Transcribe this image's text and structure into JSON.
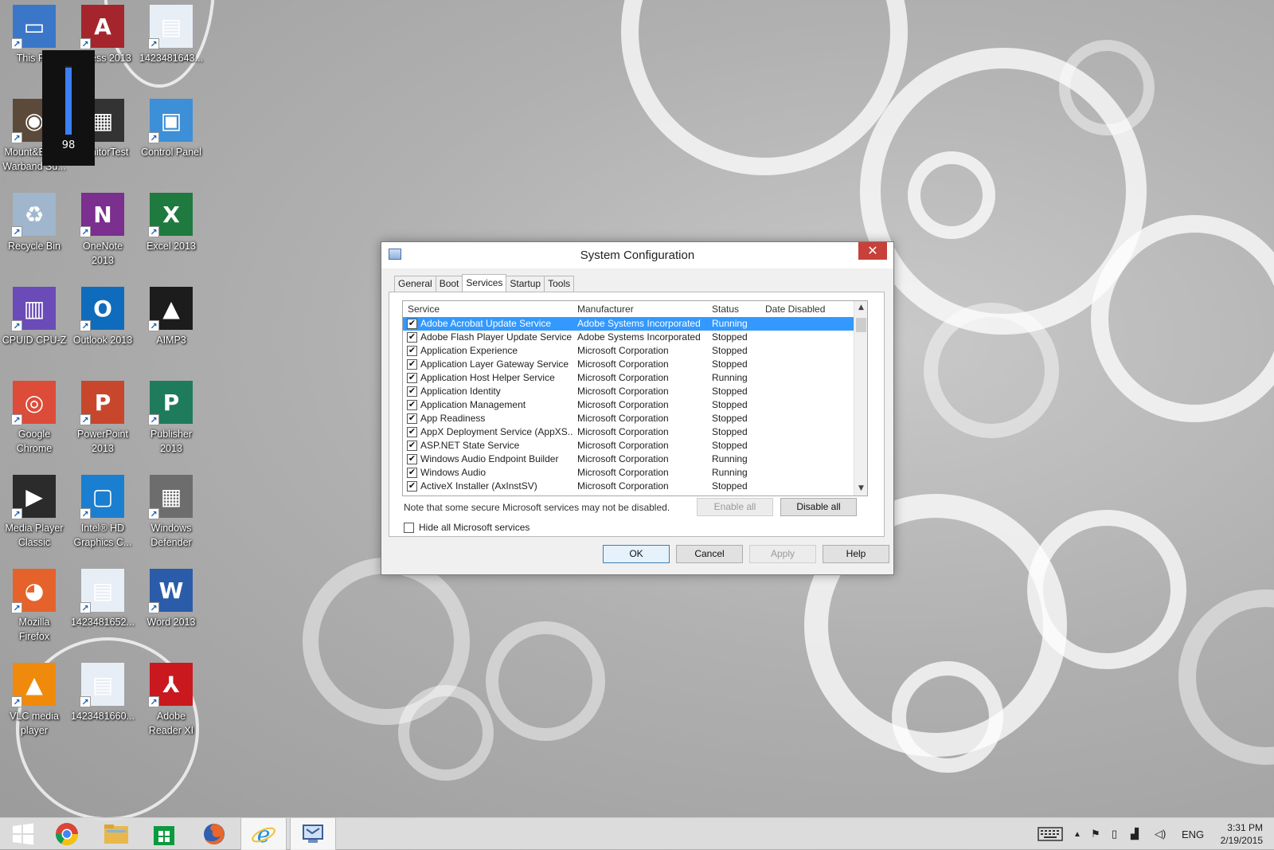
{
  "desktop": {
    "icons": [
      {
        "label": "This PC",
        "color": "#3a77c9",
        "glyph": "▭"
      },
      {
        "label": "Access 2013",
        "color": "#a4262c",
        "glyph": "A"
      },
      {
        "label": "1423481643...",
        "color": "#e8eef6",
        "glyph": "▤"
      },
      {
        "label": "Mount&Blade\nWarband Su...",
        "color": "#5b4a3a",
        "glyph": "◉"
      },
      {
        "label": "MonitorTest",
        "color": "#333333",
        "glyph": "▦"
      },
      {
        "label": "Control Panel",
        "color": "#3d8fd8",
        "glyph": "▣"
      },
      {
        "label": "Recycle Bin",
        "color": "#9fb6cc",
        "glyph": "♻"
      },
      {
        "label": "OneNote\n2013",
        "color": "#7b2f8e",
        "glyph": "N"
      },
      {
        "label": "Excel 2013",
        "color": "#1f7a3f",
        "glyph": "X"
      },
      {
        "label": "CPUID CPU-Z",
        "color": "#6a4bb8",
        "glyph": "▥"
      },
      {
        "label": "Outlook 2013",
        "color": "#0f6cbd",
        "glyph": "O"
      },
      {
        "label": "AIMP3",
        "color": "#1c1c1c",
        "glyph": "▲"
      },
      {
        "label": "Google\nChrome",
        "color": "#dd4b39",
        "glyph": "◎"
      },
      {
        "label": "PowerPoint\n2013",
        "color": "#c8472c",
        "glyph": "P"
      },
      {
        "label": "Publisher\n2013",
        "color": "#1e7b5b",
        "glyph": "P"
      },
      {
        "label": "Media Player\nClassic",
        "color": "#2b2b2b",
        "glyph": "▶"
      },
      {
        "label": "Intel® HD\nGraphics C...",
        "color": "#1a7fd1",
        "glyph": "▢"
      },
      {
        "label": "Windows\nDefender",
        "color": "#6d6d6d",
        "glyph": "▦"
      },
      {
        "label": "Mozilla\nFirefox",
        "color": "#e5632a",
        "glyph": "◕"
      },
      {
        "label": "1423481652...",
        "color": "#e8eef6",
        "glyph": "▤"
      },
      {
        "label": "Word 2013",
        "color": "#2a5caa",
        "glyph": "W"
      },
      {
        "label": "VLC media\nplayer",
        "color": "#f08a0c",
        "glyph": "▲"
      },
      {
        "label": "1423481660...",
        "color": "#e8eef6",
        "glyph": "▤"
      },
      {
        "label": "Adobe\nReader XI",
        "color": "#c9181e",
        "glyph": "⅄"
      }
    ]
  },
  "volume": {
    "level_text": "98",
    "level_fraction": 0.98,
    "accent": "#3b7ff5"
  },
  "dialog": {
    "title": "System Configuration",
    "close_glyph": "✕",
    "tabs": [
      "General",
      "Boot",
      "Services",
      "Startup",
      "Tools"
    ],
    "active_tab": "Services",
    "columns": {
      "service": "Service",
      "manufacturer": "Manufacturer",
      "status": "Status",
      "date_disabled": "Date Disabled"
    },
    "rows": [
      {
        "service": "Adobe Acrobat Update Service",
        "manufacturer": "Adobe Systems Incorporated",
        "status": "Running",
        "date": "",
        "checked": true,
        "selected": true
      },
      {
        "service": "Adobe Flash Player Update Service",
        "manufacturer": "Adobe Systems Incorporated",
        "status": "Stopped",
        "date": "",
        "checked": true
      },
      {
        "service": "Application Experience",
        "manufacturer": "Microsoft Corporation",
        "status": "Stopped",
        "date": "",
        "checked": true
      },
      {
        "service": "Application Layer Gateway Service",
        "manufacturer": "Microsoft Corporation",
        "status": "Stopped",
        "date": "",
        "checked": true
      },
      {
        "service": "Application Host Helper Service",
        "manufacturer": "Microsoft Corporation",
        "status": "Running",
        "date": "",
        "checked": true
      },
      {
        "service": "Application Identity",
        "manufacturer": "Microsoft Corporation",
        "status": "Stopped",
        "date": "",
        "checked": true
      },
      {
        "service": "Application Management",
        "manufacturer": "Microsoft Corporation",
        "status": "Stopped",
        "date": "",
        "checked": true
      },
      {
        "service": "App Readiness",
        "manufacturer": "Microsoft Corporation",
        "status": "Stopped",
        "date": "",
        "checked": true
      },
      {
        "service": "AppX Deployment Service (AppXS...",
        "manufacturer": "Microsoft Corporation",
        "status": "Stopped",
        "date": "",
        "checked": true
      },
      {
        "service": "ASP.NET State Service",
        "manufacturer": "Microsoft Corporation",
        "status": "Stopped",
        "date": "",
        "checked": true
      },
      {
        "service": "Windows Audio Endpoint Builder",
        "manufacturer": "Microsoft Corporation",
        "status": "Running",
        "date": "",
        "checked": true
      },
      {
        "service": "Windows Audio",
        "manufacturer": "Microsoft Corporation",
        "status": "Running",
        "date": "",
        "checked": true
      },
      {
        "service": "ActiveX Installer (AxInstSV)",
        "manufacturer": "Microsoft Corporation",
        "status": "Stopped",
        "date": "",
        "checked": true
      }
    ],
    "note": "Note that some secure Microsoft services may not be disabled.",
    "enable_all": "Enable all",
    "disable_all": "Disable all",
    "hide_ms_label": "Hide all Microsoft services",
    "ok": "OK",
    "cancel": "Cancel",
    "apply": "Apply",
    "help": "Help"
  },
  "taskbar": {
    "apps": [
      {
        "name": "start-button",
        "icon": "windows-logo-icon"
      },
      {
        "name": "chrome",
        "icon": "chrome-icon"
      },
      {
        "name": "file-explorer",
        "icon": "folder-icon"
      },
      {
        "name": "store",
        "icon": "store-icon"
      },
      {
        "name": "firefox",
        "icon": "firefox-icon"
      },
      {
        "name": "internet-explorer",
        "icon": "ie-icon"
      },
      {
        "name": "system-configuration",
        "icon": "msconfig-icon"
      }
    ],
    "language": "ENG",
    "time": "3:31 PM",
    "date": "2/19/2015"
  }
}
